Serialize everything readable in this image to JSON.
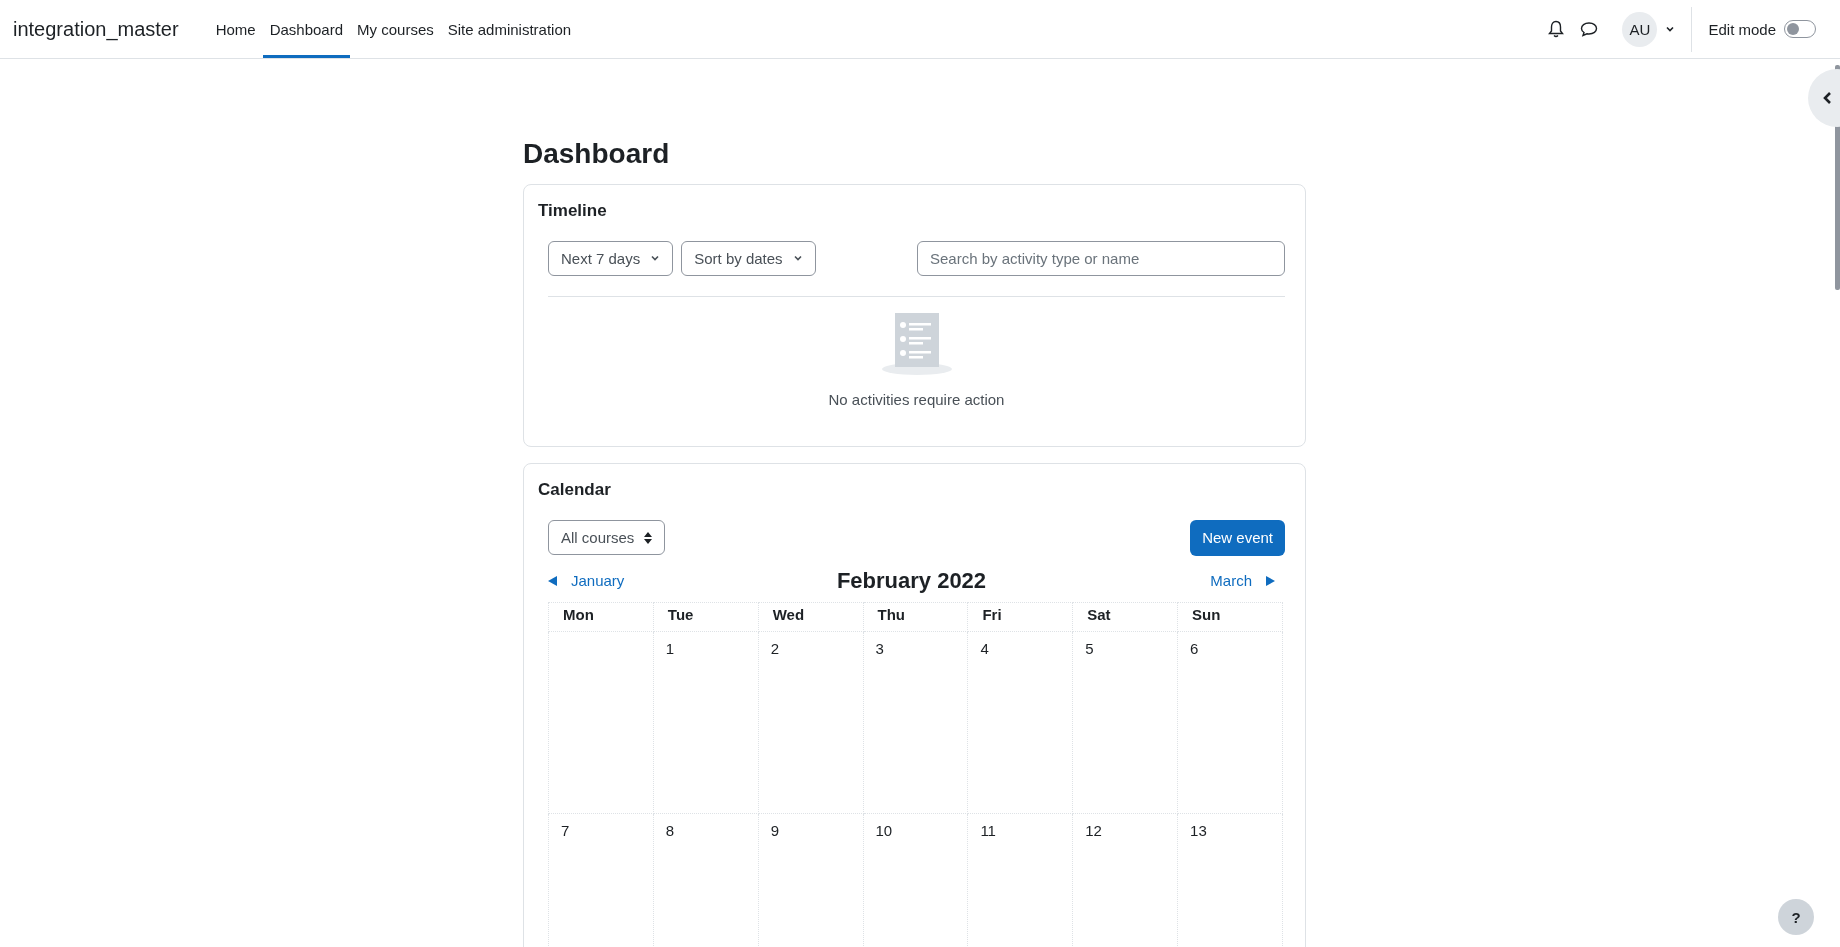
{
  "navbar": {
    "brand": "integration_master",
    "items": [
      {
        "label": "Home",
        "selected": false
      },
      {
        "label": "Dashboard",
        "selected": true
      },
      {
        "label": "My courses",
        "selected": false
      },
      {
        "label": "Site administration",
        "selected": false
      }
    ],
    "avatar": "AU",
    "edit_mode": {
      "label": "Edit mode",
      "on": false
    }
  },
  "page_title": "Dashboard",
  "timeline": {
    "title": "Timeline",
    "filters": [
      "Next 7 days",
      "Sort by dates"
    ],
    "search": {
      "placeholder": "Search by activity type or name"
    },
    "empty_message": "No activities require action"
  },
  "calendar": {
    "title": "Calendar",
    "course_filter": "All courses",
    "new_event_button": "New event",
    "prev_month": "January",
    "month_title": "February 2022",
    "next_month": "March",
    "weekdays": [
      "Mon",
      "Tue",
      "Wed",
      "Thu",
      "Fri",
      "Sat",
      "Sun"
    ],
    "weeks": [
      {
        "starts_midweek": true,
        "days": [
          "1",
          "2",
          "3",
          "4",
          "5",
          "6"
        ]
      },
      {
        "starts_midweek": false,
        "days": [
          "7",
          "8",
          "9",
          "10",
          "11",
          "12",
          "13"
        ]
      }
    ]
  },
  "help_button": "?"
}
